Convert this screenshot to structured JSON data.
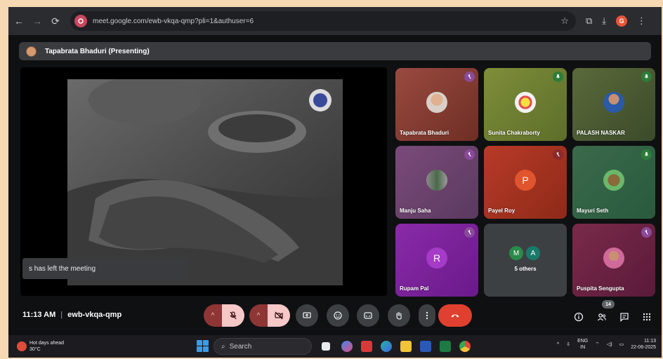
{
  "browser": {
    "url": "meet.google.com/ewb-vkqa-qmp?pli=1&authuser=6",
    "profile_initial": "G"
  },
  "presenting": {
    "label": "Tapabrata Bhaduri (Presenting)"
  },
  "toast": {
    "text": "s has left the meeting"
  },
  "participants": [
    {
      "name": "Tapabrata Bhaduri",
      "muted": true,
      "type": "photo"
    },
    {
      "name": "Sunita Chakraborty",
      "muted": false,
      "type": "photo"
    },
    {
      "name": "PALASH NASKAR",
      "muted": false,
      "type": "photo"
    },
    {
      "name": "Manju Saha",
      "muted": true,
      "type": "photo"
    },
    {
      "name": "Payel Roy",
      "muted": true,
      "type": "letter",
      "initial": "P"
    },
    {
      "name": "Mayuri Seth",
      "muted": false,
      "type": "photo"
    },
    {
      "name": "Rupam Pal",
      "muted": true,
      "type": "letter",
      "initial": "R"
    },
    {
      "name": "5 others",
      "type": "others",
      "initials": [
        "M",
        "A"
      ]
    },
    {
      "name": "Puspita Sengupta",
      "muted": true,
      "type": "photo"
    }
  ],
  "meeting": {
    "time": "11:13 AM",
    "code": "ewb-vkqa-qmp",
    "participant_count": "14"
  },
  "taskbar": {
    "weather_title": "Hot days ahead",
    "weather_temp": "30°C",
    "search_placeholder": "Search",
    "lang_top": "ENG",
    "lang_bottom": "IN",
    "clock_time": "11:13",
    "clock_date": "22-06-2025"
  },
  "colors": {
    "page_bg": "#f6d9b3",
    "meet_bg": "#0f1012",
    "end_call": "#e0402f",
    "mic_off_bg": "#f6c8c8",
    "muted_badge": "#8a4a9a",
    "unmuted_badge": "#2d7d3a"
  }
}
